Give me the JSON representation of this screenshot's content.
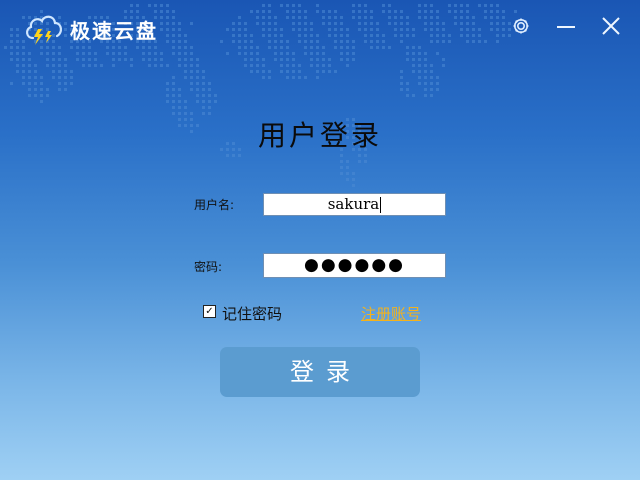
{
  "app": {
    "title": "极速云盘",
    "logo_icon": "cloud-lightning-icon"
  },
  "titlebar": {
    "settings_icon": "gear-icon",
    "minimize_icon": "minimize-icon",
    "close_icon": "close-icon"
  },
  "login": {
    "heading": "用户登录",
    "username_label": "用户名:",
    "username_value": "sakura",
    "password_label": "密码:",
    "password_masked": "●●●●●●",
    "remember_label": "记住密码",
    "remember_checked": true,
    "register_link": "注册账号",
    "submit_label": "登录"
  },
  "colors": {
    "background_top": "#1a56b4",
    "background_bottom": "#9fd0f4",
    "button": "#5b9cd0",
    "link": "#f4b21c",
    "map_dots": "#4d8ad4"
  }
}
